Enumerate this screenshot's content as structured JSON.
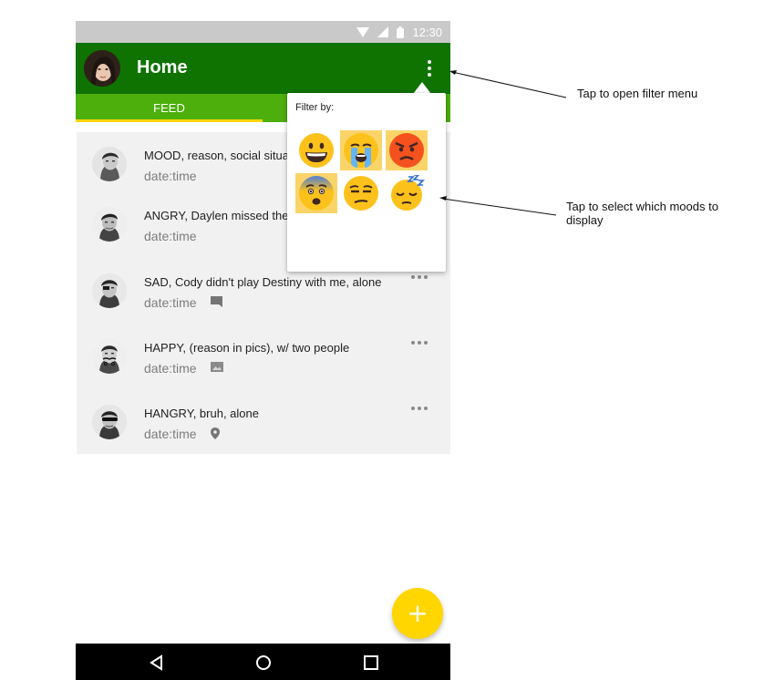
{
  "status_bar": {
    "time": "12:30"
  },
  "app_bar": {
    "title": "Home"
  },
  "tabs": [
    {
      "label": "FEED",
      "active": true
    }
  ],
  "feed": [
    {
      "title": "MOOD, reason, social situat",
      "date": "date:time",
      "meta_icon": "none"
    },
    {
      "title": "ANGRY, Daylen missed the me",
      "date": "date:time",
      "meta_icon": "none"
    },
    {
      "title": "SAD, Cody didn't play Destiny with me, alone",
      "date": "date:time",
      "meta_icon": "comment-icon"
    },
    {
      "title": "HAPPY, (reason in pics), w/ two people",
      "date": "date:time",
      "meta_icon": "image-icon"
    },
    {
      "title": "HANGRY, bruh, alone",
      "date": "date:time",
      "meta_icon": "location-pin-icon"
    }
  ],
  "filter_menu": {
    "label": "Filter by:",
    "moods": [
      {
        "name": "happy",
        "icon": "grinning-face-icon",
        "selected": false
      },
      {
        "name": "crying",
        "icon": "crying-face-icon",
        "selected": true
      },
      {
        "name": "angry",
        "icon": "angry-face-icon",
        "selected": true
      },
      {
        "name": "anxious",
        "icon": "anxious-face-icon",
        "selected": true
      },
      {
        "name": "unamused",
        "icon": "unamused-face-icon",
        "selected": false
      },
      {
        "name": "sleepy",
        "icon": "sleeping-face-icon",
        "selected": false
      }
    ]
  },
  "fab": {
    "label": "+"
  },
  "annotations": {
    "filter_menu_hint": "Tap to open filter menu",
    "mood_select_hint": "Tap to select which moods to display"
  },
  "colors": {
    "app_bar": "#0e7300",
    "tab_bar": "#4caf0c",
    "accent": "#ffd600",
    "selected_mood": "#fbd469",
    "feed_background": "#f1f1f1"
  }
}
